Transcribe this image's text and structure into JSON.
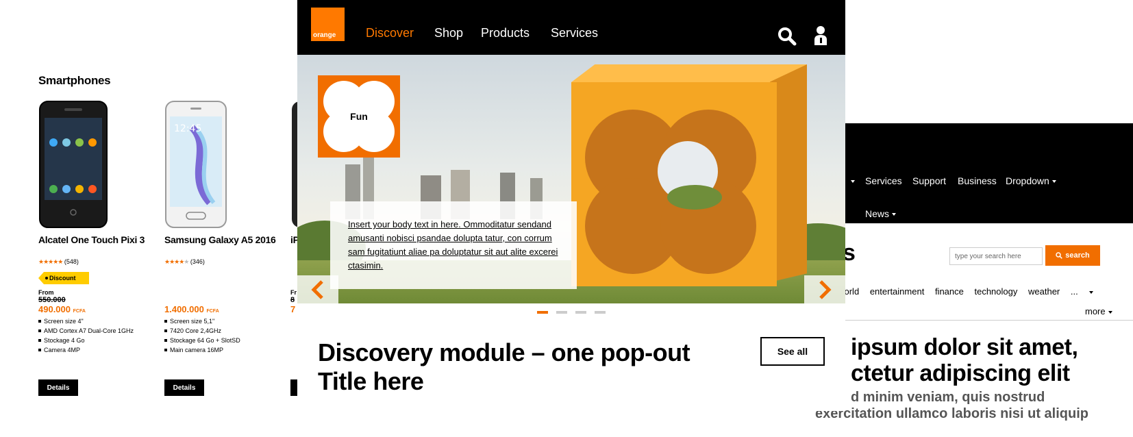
{
  "left": {
    "section_title": "Smartphones",
    "products": [
      {
        "name": "Alcatel One Touch Pixi 3",
        "stars": 5,
        "reviews": "(548)",
        "badge": "Discount",
        "from_label": "From",
        "old_price": "550.000",
        "price": "490.000",
        "currency": "FCFA",
        "specs": [
          "Screen size 4\"",
          "AMD Cortex A7 Dual-Core 1GHz",
          "Stockage 4 Go",
          "Camera 4MP"
        ],
        "details_label": "Details"
      },
      {
        "name": "Samsung Galaxy A5 2016",
        "stars": 4,
        "reviews": "(346)",
        "price": "1.400.000",
        "currency": "FCFA",
        "specs": [
          "Screen size 5,1\"",
          "7420 Core 2,4GHz",
          "Stockage 64 Go + SlotSD",
          "Main camera 16MP"
        ],
        "details_label": "Details"
      },
      {
        "name": "iP",
        "from_label": "Fr",
        "old_price": "8",
        "price": "7"
      }
    ]
  },
  "center": {
    "logo_text": "orange",
    "nav": [
      {
        "label": "Discover",
        "active": true
      },
      {
        "label": "Shop",
        "active": false
      },
      {
        "label": "Products",
        "active": false
      },
      {
        "label": "Services",
        "active": false
      }
    ],
    "hero": {
      "tile_label": "Fun",
      "caption": "Insert your body text in here. Ommoditatur sendand amusanti nobisci psandae dolupta tatur, con corrum sam fugitatiunt aliae pa doluptatur sit aut alite excerei ctasimin.",
      "slide_count": 4,
      "active_slide": 1
    },
    "discovery_title": "Discovery module – one pop-out Title here",
    "see_all_label": "See all"
  },
  "right": {
    "nav_row1": [
      "Services",
      "Support",
      "Business",
      "Dropdown"
    ],
    "nav_row2": [
      "News"
    ],
    "search_placeholder": "type your search here",
    "search_button": "search",
    "heading_fragment": "s",
    "topics": [
      "world",
      "entertainment",
      "finance",
      "technology",
      "weather",
      "..."
    ],
    "topics_first_partial": "vorld",
    "more_label": "more",
    "headline_line1": "ipsum dolor sit amet,",
    "headline_line2": "ctetur adipiscing elit",
    "subline1": "d minim veniam, quis nostrud",
    "subline2": "exercitation ullamco laboris nisi ut aliquip"
  },
  "colors": {
    "brand_orange": "#ff7900",
    "accent_orange": "#f16e00",
    "badge_yellow": "#ffcc00",
    "nav_black": "#000000"
  }
}
